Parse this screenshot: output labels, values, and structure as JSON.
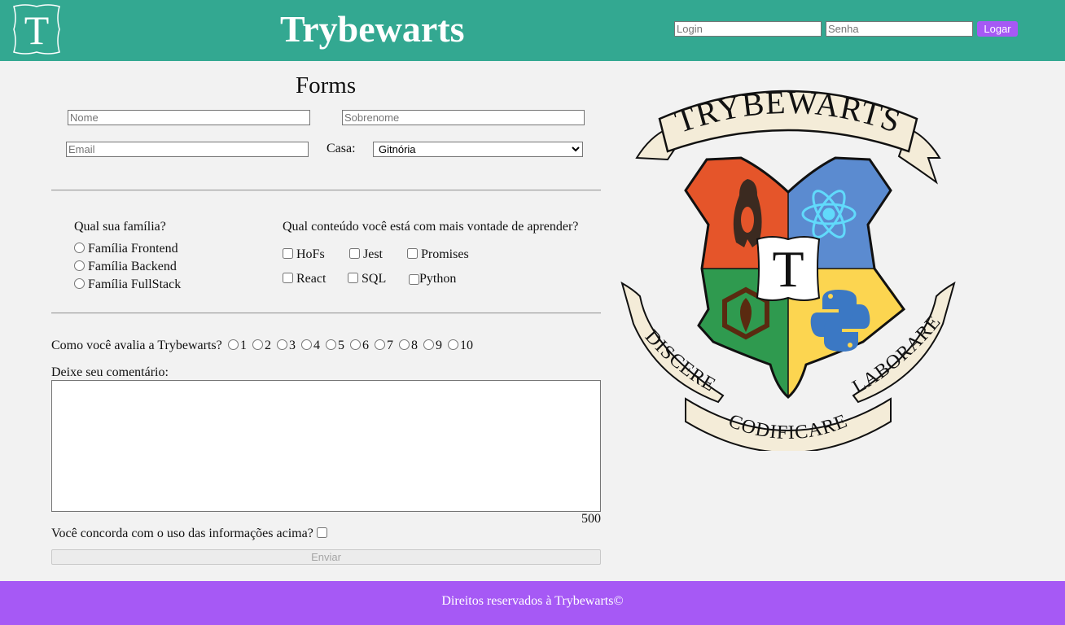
{
  "header": {
    "logo_letter": "T",
    "title": "Trybewarts",
    "login": {
      "email_placeholder": "Login",
      "password_placeholder": "Senha",
      "button_label": "Logar"
    }
  },
  "form": {
    "title": "Forms",
    "first_name_placeholder": "Nome",
    "last_name_placeholder": "Sobrenome",
    "email_placeholder": "Email",
    "house_label": "Casa:",
    "house_selected": "Gitnória",
    "family": {
      "question": "Qual sua família?",
      "options": [
        "Família Frontend",
        "Família Backend",
        "Família FullStack"
      ]
    },
    "subjects": {
      "question": "Qual conteúdo você está com mais vontade de aprender?",
      "options": [
        "HoFs",
        "Jest",
        "Promises",
        "React",
        "SQL",
        "Python"
      ]
    },
    "rating": {
      "question": "Como você avalia a Trybewarts?",
      "options": [
        "1",
        "2",
        "3",
        "4",
        "5",
        "6",
        "7",
        "8",
        "9",
        "10"
      ]
    },
    "comment_label": "Deixe seu comentário:",
    "char_counter": "500",
    "agreement_label": "Você concorda com o uso das informações acima?",
    "submit_label": "Enviar"
  },
  "crest": {
    "banner_top": "TRYBEWARTS",
    "center_letter": "T",
    "motto_left": "DISCERE",
    "motto_bottom": "CODIFICARE",
    "motto_right": "LABORARE"
  },
  "footer": {
    "text": "Direitos reservados à Trybewarts©"
  },
  "colors": {
    "header_bg": "#33a891",
    "footer_bg": "#a659f5",
    "button_bg": "#a659f5",
    "page_bg": "#f2f2f2",
    "crest_red": "#e5552a",
    "crest_blue": "#5b8bd0",
    "crest_green": "#2f9a4f",
    "crest_yellow": "#fcd550"
  }
}
